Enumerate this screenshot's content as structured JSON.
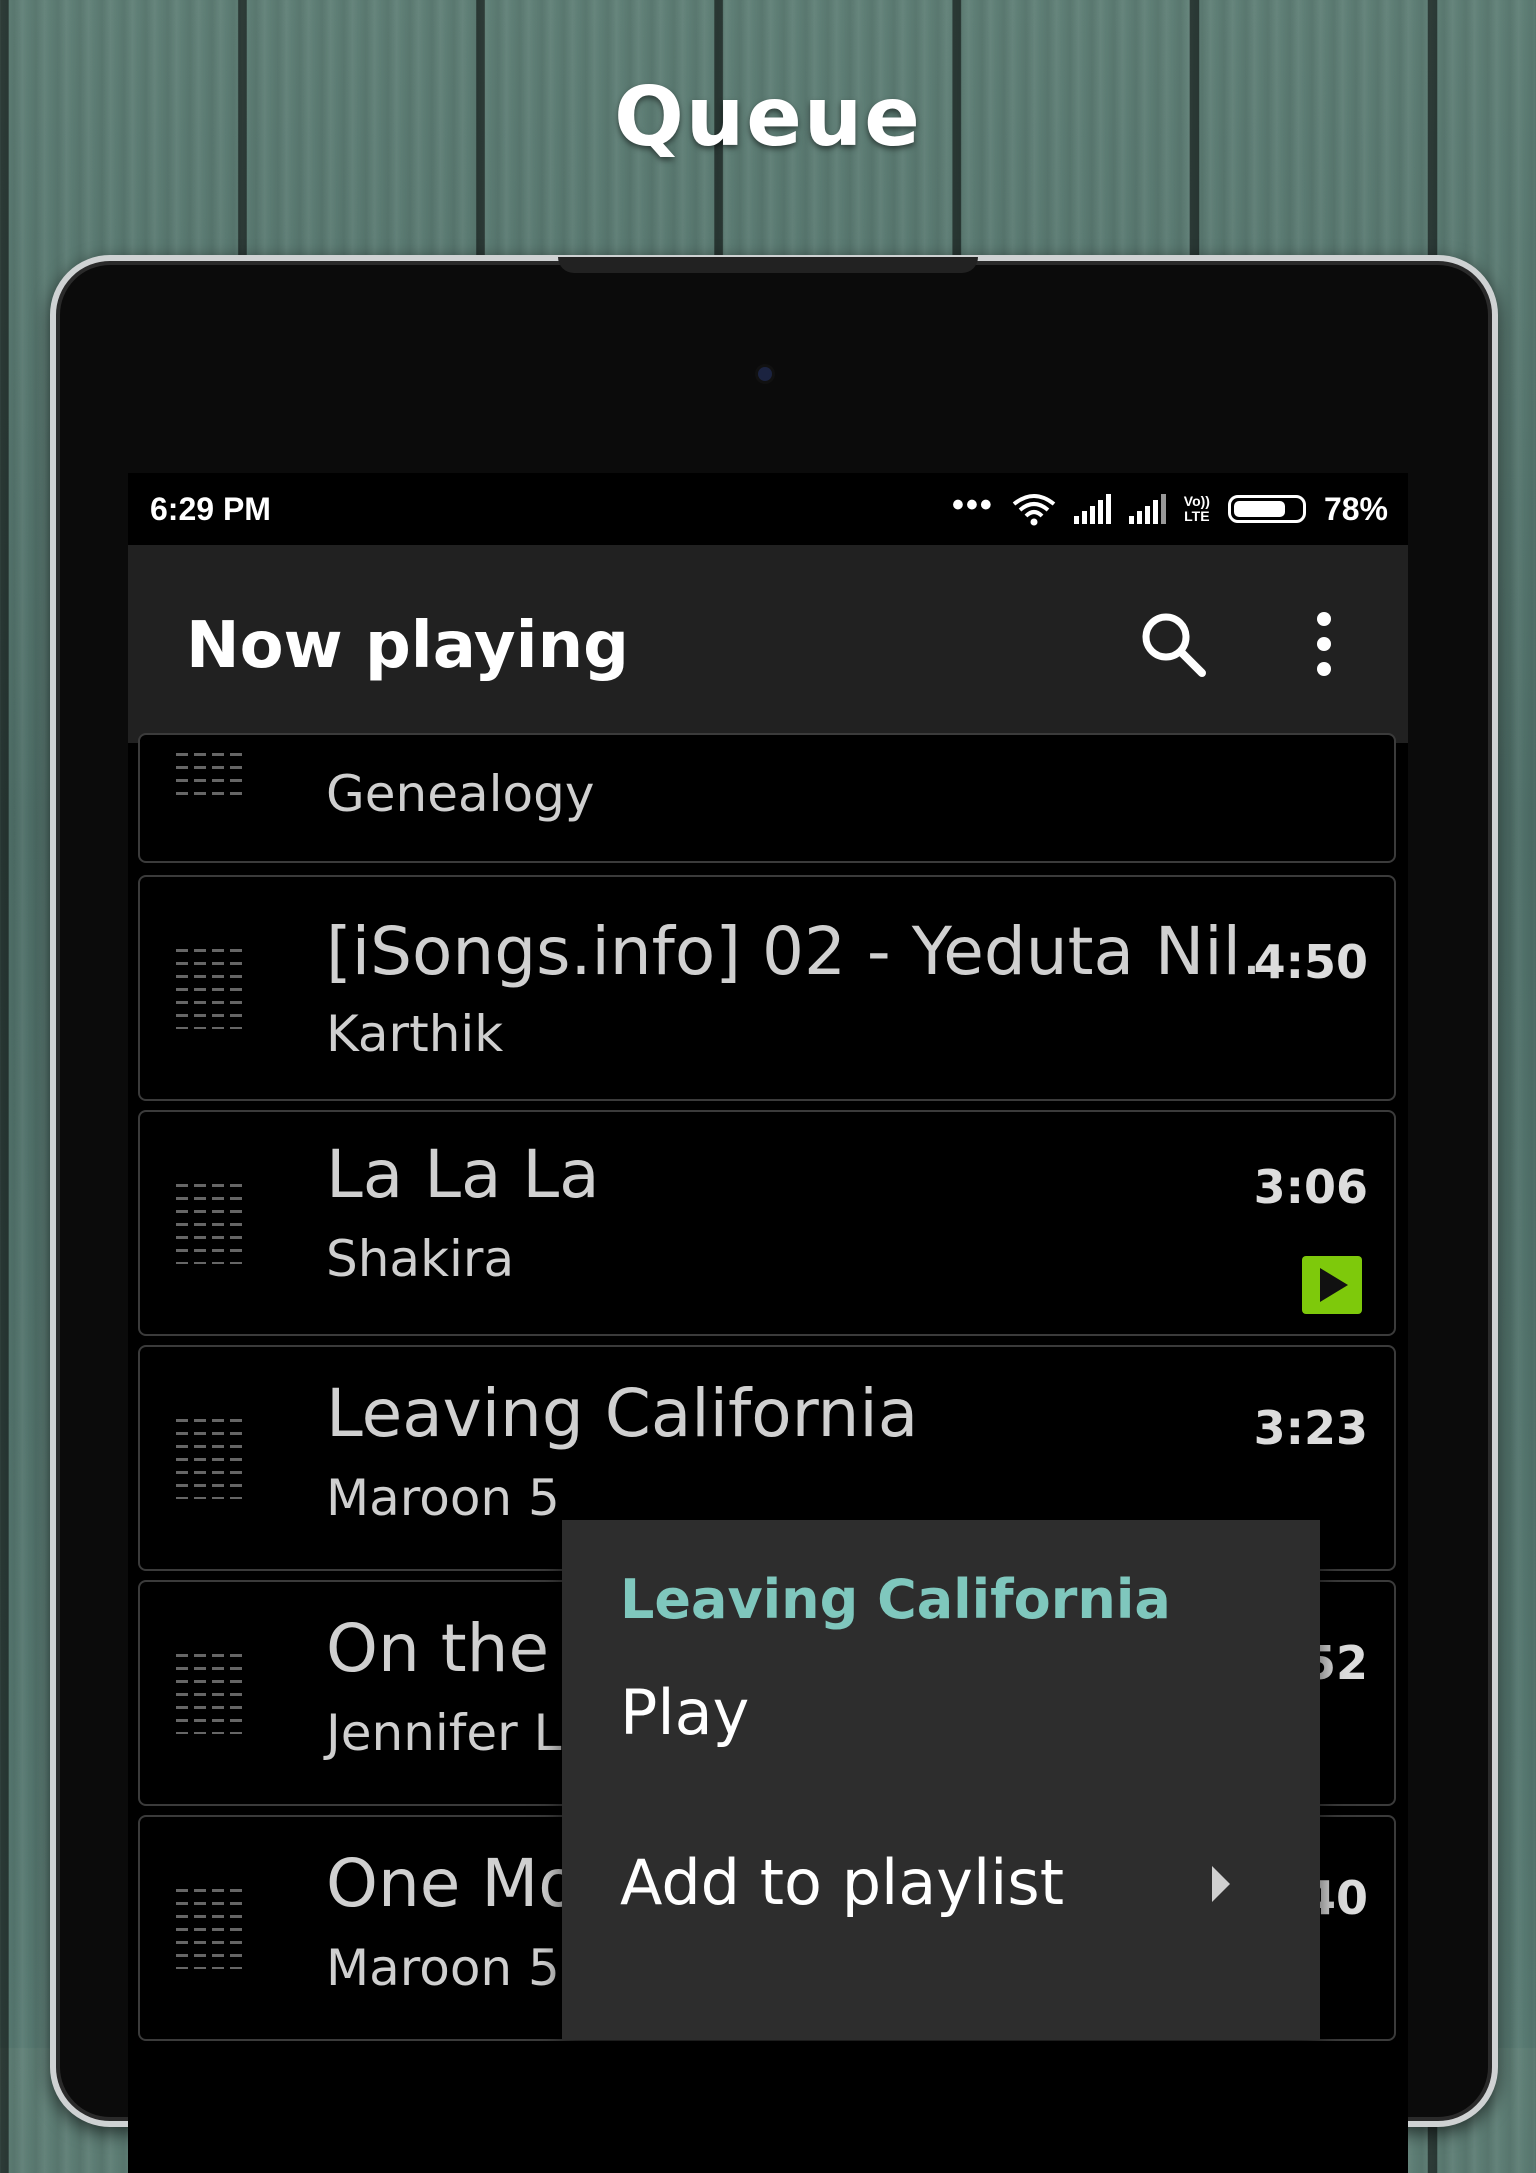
{
  "promo": {
    "title": "Queue"
  },
  "status_bar": {
    "time": "6:29 PM",
    "dots": "•••",
    "volte_top": "Vo))",
    "volte_bottom": "LTE",
    "battery": "78%"
  },
  "toolbar": {
    "title": "Now playing",
    "search_icon": "search-icon",
    "more_icon": "more-vert-icon"
  },
  "queue": [
    {
      "title": "",
      "artist": "Genealogy",
      "duration": ""
    },
    {
      "title": "[iSongs.info] 02 - Yeduta Nil..",
      "artist": "Karthik",
      "duration": "4:50"
    },
    {
      "title": "La La La",
      "artist": "Shakira",
      "duration": "3:06",
      "playing": true
    },
    {
      "title": "Leaving California",
      "artist": "Maroon 5",
      "duration": "3:23"
    },
    {
      "title": "On the",
      "artist": "Jennifer L",
      "duration": "52"
    },
    {
      "title": "One Mo",
      "artist": "Maroon 5",
      "duration": "40"
    }
  ],
  "context_menu": {
    "header": "Leaving California",
    "items": [
      {
        "label": "Play"
      },
      {
        "label": "Add to playlist",
        "has_submenu": true
      }
    ]
  },
  "colors": {
    "accent": "#7fc7bd",
    "playing_badge": "#7ec90b",
    "toolbar": "#212121"
  }
}
